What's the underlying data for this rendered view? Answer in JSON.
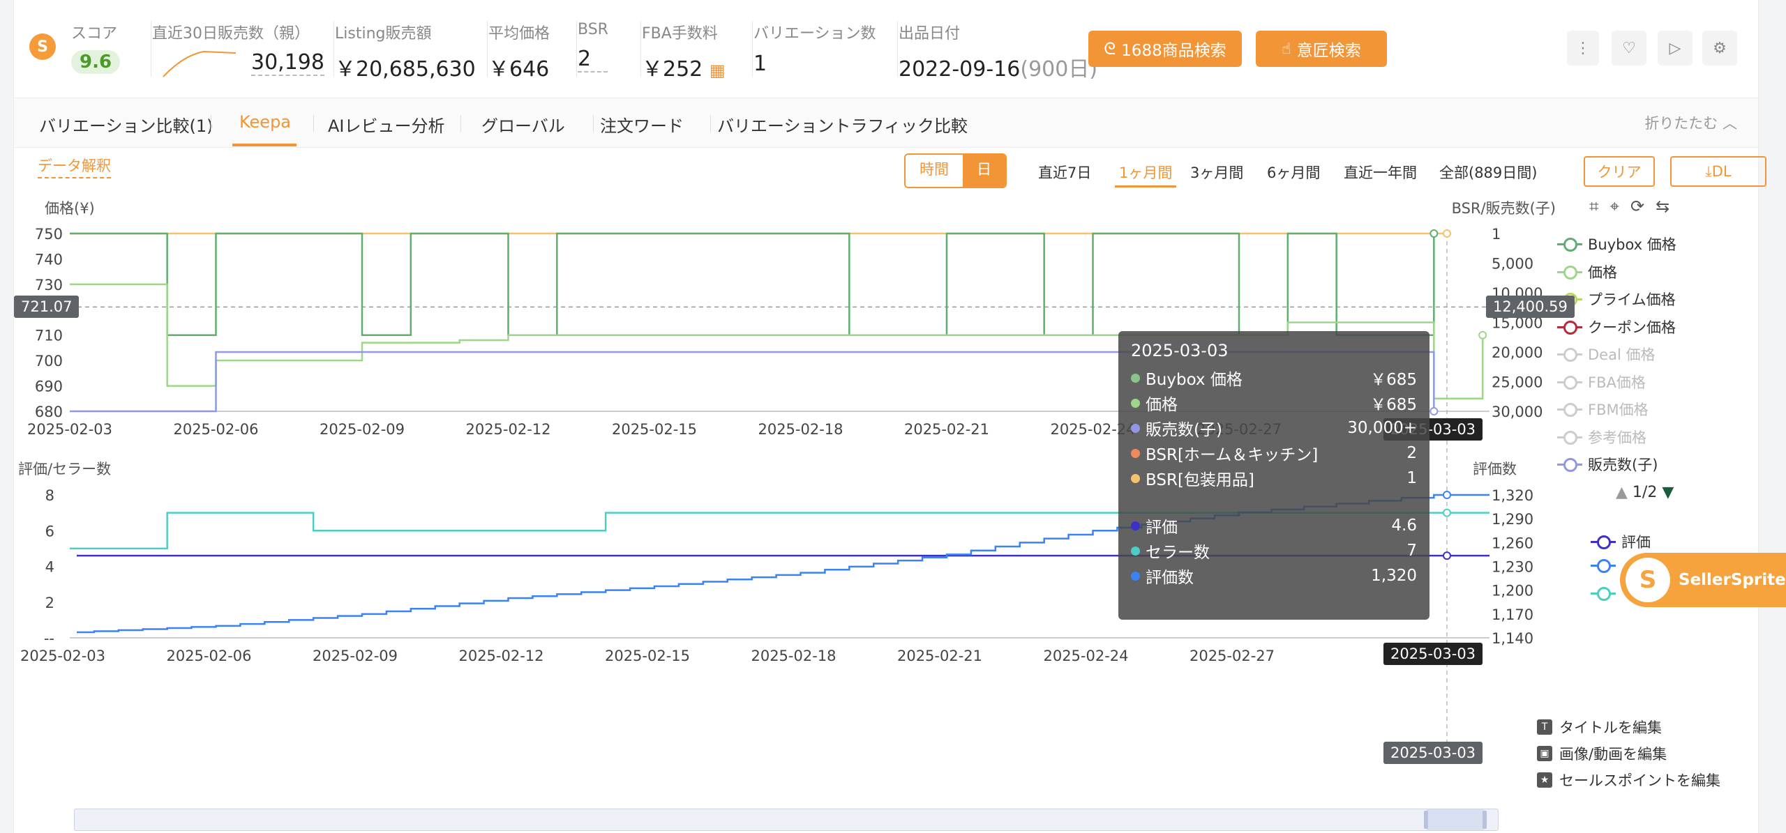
{
  "header": {
    "score_label": "スコア",
    "score_value": "9.6",
    "sales30_label": "直近30日販売数（親）",
    "sales30_value": "30,198",
    "listing_label": "Listing販売額",
    "listing_value": "￥20,685,630",
    "avgprice_label": "平均価格",
    "avgprice_value": "￥646",
    "bsr_label": "BSR",
    "bsr_value": "2",
    "fba_label": "FBA手数料",
    "fba_value": "￥252",
    "variations_label": "バリエーション数",
    "variations_value": "1",
    "listed_label": "出品日付",
    "listed_value": "2022-09-16",
    "listed_days": "(900日)",
    "btn_1688": "1688商品検索",
    "btn_design": "意匠検索"
  },
  "tabs": [
    {
      "label": "バリエーション比較(1)"
    },
    {
      "label": "Keepa"
    },
    {
      "label": "AIレビュー分析"
    },
    {
      "label": "グローバル"
    },
    {
      "label": "注文ワード"
    },
    {
      "label": "バリエーショントラフィック比較"
    }
  ],
  "fold_label": "折りたたむ",
  "toolbar": {
    "data_explain": "データ解釈",
    "seg_hour": "時間",
    "seg_day": "日",
    "ranges": [
      "直近7日",
      "1ヶ月間",
      "3ヶ月間",
      "6ヶ月間",
      "直近一年間",
      "全部(889日間)"
    ],
    "clear": "クリア",
    "dl": "DL"
  },
  "chart_data": [
    {
      "type": "line",
      "ylabel_left": "価格(¥)",
      "ylabel_right": "BSR/販売数(子)",
      "ylim_left": [
        680,
        750
      ],
      "yticks_left": [
        680,
        690,
        700,
        710,
        720,
        730,
        740,
        750
      ],
      "yticks_right": [
        "1",
        "5,000",
        "10,000",
        "15,000",
        "20,000",
        "25,000",
        "30,000"
      ],
      "x_ticks": [
        "2025-02-03",
        "2025-02-06",
        "2025-02-09",
        "2025-02-12",
        "2025-02-15",
        "2025-02-18",
        "2025-02-21",
        "2025-02-24",
        "2025-02-27",
        "2025-03-03"
      ],
      "crosshair_left": "721.07",
      "crosshair_right": "12,400.59",
      "crosshair_date": "2025-03-03",
      "series": [
        {
          "name": "Buybox 価格",
          "color": "#5fae6e",
          "x": [
            "2025-02-03",
            "2025-02-05",
            "2025-02-06",
            "2025-02-09",
            "2025-02-10",
            "2025-02-12",
            "2025-02-13",
            "2025-02-19",
            "2025-02-21",
            "2025-02-23",
            "2025-02-24",
            "2025-02-27",
            "2025-02-28",
            "2025-03-01",
            "2025-03-03"
          ],
          "values": [
            750,
            710,
            750,
            710,
            750,
            710,
            750,
            710,
            750,
            710,
            750,
            710,
            750,
            710,
            750
          ]
        },
        {
          "name": "価格",
          "color": "#9ed688",
          "x": [
            "2025-02-03",
            "2025-02-04",
            "2025-02-05",
            "2025-02-06",
            "2025-02-09",
            "2025-02-11",
            "2025-02-12",
            "2025-02-25",
            "2025-02-28",
            "2025-03-03",
            "2025-03-04"
          ],
          "values": [
            730,
            730,
            690,
            700,
            707,
            708,
            710,
            710,
            715,
            685,
            710
          ]
        },
        {
          "name": "プライム価格",
          "color": "#b8d95a",
          "values": []
        },
        {
          "name": "クーポン価格",
          "color": "#b8293a",
          "values": []
        },
        {
          "name": "Deal 価格",
          "color": "#cccccc",
          "values": []
        },
        {
          "name": "FBA価格",
          "color": "#cccccc",
          "values": []
        },
        {
          "name": "FBM価格",
          "color": "#cccccc",
          "values": []
        },
        {
          "name": "参考価格",
          "color": "#cccccc",
          "values": []
        },
        {
          "name": "販売数(子)",
          "color": "#8f97e6",
          "x": [
            "2025-02-03",
            "2025-02-05",
            "2025-02-06",
            "2025-03-03"
          ],
          "values": [
            30000,
            30000,
            20000,
            30000
          ]
        },
        {
          "name": "BSR[包装用品]",
          "color": "#f5c26b",
          "values": [
            1,
            1
          ]
        }
      ],
      "legend_page": "1/2"
    },
    {
      "type": "line",
      "ylabel_left": "評価/セラー数",
      "ylabel_right": "評価数",
      "yticks_left": [
        "--",
        "2",
        "4",
        "6",
        "8"
      ],
      "yticks_right": [
        "1,140",
        "1,170",
        "1,200",
        "1,230",
        "1,260",
        "1,290",
        "1,320"
      ],
      "x_ticks": [
        "2025-02-03",
        "2025-02-06",
        "2025-02-09",
        "2025-02-12",
        "2025-02-15",
        "2025-02-18",
        "2025-02-21",
        "2025-02-24",
        "2025-02-27",
        "2025-03-03"
      ],
      "crosshair_date": "2025-03-03",
      "series": [
        {
          "name": "評価",
          "color": "#3d2fc8",
          "values": [
            4.6,
            4.6
          ]
        },
        {
          "name": "セラー数",
          "color": "#4ecdc4",
          "x": [
            "2025-02-03",
            "2025-02-05",
            "2025-02-08",
            "2025-02-14",
            "2025-03-03"
          ],
          "values": [
            5,
            7,
            6,
            7,
            7
          ]
        },
        {
          "name": "評価数",
          "color": "#3b82f6",
          "x": [
            "2025-02-03",
            "2025-02-06",
            "2025-02-09",
            "2025-02-12",
            "2025-02-15",
            "2025-02-18",
            "2025-02-21",
            "2025-02-24",
            "2025-02-27",
            "2025-03-03"
          ],
          "values": [
            1147,
            1155,
            1170,
            1190,
            1205,
            1222,
            1245,
            1275,
            1298,
            1320
          ]
        }
      ]
    }
  ],
  "tooltip": {
    "date": "2025-03-03",
    "rows": [
      {
        "label": "Buybox 価格",
        "value": "￥685",
        "color": "#8bc48a"
      },
      {
        "label": "価格",
        "value": "￥685",
        "color": "#9ed688"
      },
      {
        "label": "販売数(子)",
        "value": "30,000+",
        "color": "#8f97e6"
      },
      {
        "label": "BSR[ホーム＆キッチン]",
        "value": "2",
        "color": "#f08a5d"
      },
      {
        "label": "BSR[包装用品]",
        "value": "1",
        "color": "#f5c26b"
      },
      {
        "label": "評価",
        "value": "4.6",
        "color": "#3d2fc8"
      },
      {
        "label": "セラー数",
        "value": "7",
        "color": "#4ecdc4"
      },
      {
        "label": "評価数",
        "value": "1,320",
        "color": "#3b82f6"
      }
    ]
  },
  "lower_legend": [
    {
      "label": "評価",
      "color": "#3d2fc8"
    }
  ],
  "edit_actions": [
    {
      "label": "タイトルを編集"
    },
    {
      "label": "画像/動画を編集"
    },
    {
      "label": "セールスポイントを編集"
    }
  ],
  "sellersprite": "SellerSprite",
  "colors": {
    "accent": "#f29537"
  }
}
